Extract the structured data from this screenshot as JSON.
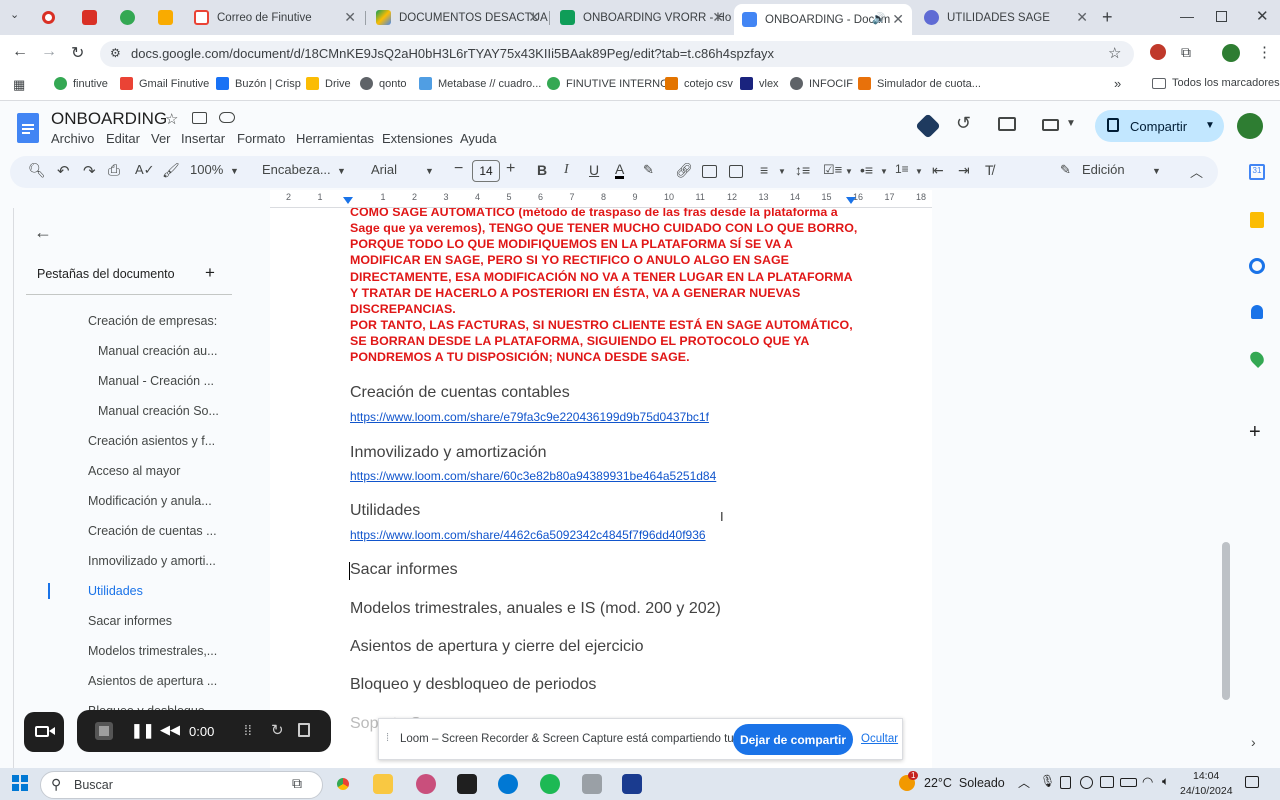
{
  "browser": {
    "tabs": [
      {
        "label": "",
        "icon": "recording-icon",
        "color": "#d93025"
      },
      {
        "label": "",
        "icon": "app-icon",
        "color": "#d93025"
      },
      {
        "label": "",
        "icon": "finutive-icon",
        "color": "#34a853"
      },
      {
        "label": "",
        "icon": "app-icon",
        "color": "#f9ab00"
      },
      {
        "label": "Correo de Finutive",
        "icon": "gmail-icon",
        "color": "#ea4335"
      },
      {
        "label": "DOCUMENTOS DESACTUAL",
        "icon": "drive-icon",
        "color": "#fbbc04"
      },
      {
        "label": "ONBOARDING VRORR - Ho",
        "icon": "sheets-icon",
        "color": "#0f9d58"
      },
      {
        "label": "ONBOARDING - Docum",
        "icon": "docs-icon",
        "color": "#4285f4"
      },
      {
        "label": "UTILIDADES SAGE",
        "icon": "gear-icon",
        "color": "#5f6bd4"
      }
    ],
    "url": "docs.google.com/document/d/18CMnKE9JsQ2aH0bH3L6rTYAY75x43KIIi5BAak89Peg/edit?tab=t.c86h4spzfayx",
    "bookmarks": [
      "finutive",
      "Gmail Finutive",
      "Buzón | Crisp",
      "Drive",
      "qonto",
      "Metabase // cuadro...",
      "FINUTIVE INTERNO",
      "cotejo csv",
      "vlex",
      "INFOCIF",
      "Simulador de cuota...",
      "Todos los marcadores"
    ]
  },
  "docs": {
    "title": "ONBOARDING",
    "menus": [
      "Archivo",
      "Editar",
      "Ver",
      "Insertar",
      "Formato",
      "Herramientas",
      "Extensiones",
      "Ayuda"
    ],
    "share_label": "Compartir",
    "toolbar": {
      "zoom": "100%",
      "style": "Encabeza...",
      "font": "Arial",
      "size": "14",
      "mode": "Edición"
    },
    "ruler": [
      "2",
      "1",
      "",
      "1",
      "2",
      "3",
      "4",
      "5",
      "6",
      "7",
      "8",
      "9",
      "10",
      "11",
      "12",
      "13",
      "14",
      "15",
      "16",
      "17",
      "18"
    ]
  },
  "sidebar": {
    "heading": "Pestañas del documento",
    "items": [
      {
        "label": "Creación de empresas:",
        "indent": 1
      },
      {
        "label": "Manual creación au...",
        "indent": 2
      },
      {
        "label": "Manual - Creación ...",
        "indent": 2
      },
      {
        "label": "Manual creación So...",
        "indent": 2
      },
      {
        "label": "Creación asientos y f...",
        "indent": 1
      },
      {
        "label": "Acceso al mayor",
        "indent": 1
      },
      {
        "label": "Modificación y anula...",
        "indent": 1
      },
      {
        "label": "Creación de cuentas ...",
        "indent": 1
      },
      {
        "label": "Inmovilizado y amorti...",
        "indent": 1
      },
      {
        "label": "Utilidades",
        "indent": 1,
        "active": true
      },
      {
        "label": "Sacar informes",
        "indent": 1
      },
      {
        "label": "Modelos trimestrales,...",
        "indent": 1
      },
      {
        "label": "Asientos de apertura ...",
        "indent": 1
      },
      {
        "label": "Bloqueo y desbloque...",
        "indent": 1
      }
    ]
  },
  "document": {
    "warning_lines": [
      "COMO SAGE AUTOMÁTICO (método de traspaso de las fras desde la plataforma a",
      "Sage que ya veremos), TENGO QUE TENER MUCHO CUIDADO CON LO QUE BORRO,",
      "PORQUE TODO LO QUE MODIFIQUEMOS EN LA PLATAFORMA SÍ SE VA A",
      "MODIFICAR EN SAGE, PERO SI YO RECTIFICO O ANULO ALGO EN SAGE",
      "DIRECTAMENTE, ESA MODIFICACIÓN NO VA A TENER LUGAR EN LA PLATAFORMA",
      "Y TRATAR DE HACERLO A POSTERIORI EN ÉSTA, VA A GENERAR NUEVAS",
      "DISCREPANCIAS.",
      "POR TANTO, LAS FACTURAS, SI NUESTRO CLIENTE ESTÁ EN SAGE AUTOMÁTICO,",
      "SE BORRAN DESDE LA PLATAFORMA, SIGUIENDO EL PROTOCOLO QUE YA",
      "PONDREMOS A TU DISPOSICIÓN; NUNCA DESDE SAGE."
    ],
    "sections": [
      {
        "heading": "Creación de cuentas contables",
        "link": "https://www.loom.com/share/e79fa3c9e220436199d9b75d0437bc1f"
      },
      {
        "heading": "Inmovilizado y amortización",
        "link": "https://www.loom.com/share/60c3e82b80a94389931be464a5251d84"
      },
      {
        "heading": "Utilidades",
        "link": "https://www.loom.com/share/4462c6a5092342c4845f7f96dd40f936"
      }
    ],
    "headings_tail": [
      "Sacar informes",
      "Modelos trimestrales, anuales e IS (mod. 200 y 202)",
      "Asientos de apertura y cierre del ejercicio",
      "Bloqueo y desbloqueo de periodos",
      "Soporte Sage"
    ]
  },
  "loom": {
    "timer": "0:00",
    "notice": "Loom – Screen Recorder & Screen Capture está compartiendo tu pantalla.",
    "stop_label": "Dejar de compartir",
    "hide_label": "Ocultar"
  },
  "taskbar": {
    "search_placeholder": "Buscar",
    "weather": "22°C  Soleado",
    "time": "14:04",
    "date": "24/10/2024",
    "notification_count": "1"
  }
}
